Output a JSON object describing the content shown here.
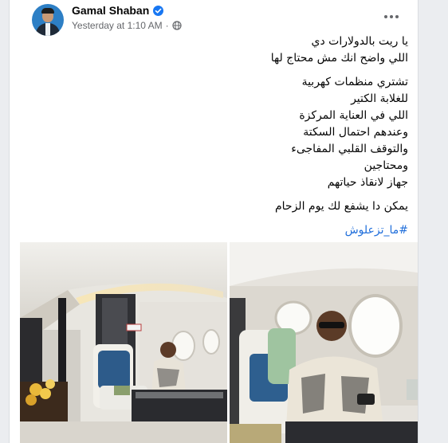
{
  "post": {
    "author": "Gamal Shaban",
    "timestamp": "Yesterday at 1:10 AM",
    "separator": "·",
    "privacy_icon": "globe-icon",
    "verified_icon": "verified-badge-icon",
    "more_icon": "more-options-icon",
    "paragraphs": [
      [
        "يا ريت بالدولارات دي",
        "اللي واضح انك مش محتاج لها"
      ],
      [
        "تشتري منظمات كهربية",
        "للغلابة الكتير",
        " اللي في العناية المركزة",
        "وعندهم احتمال السكتة",
        "والتوقف القلبي المفاجىء",
        "ومحتاجين",
        "جهاز لانقاذ حياتهم"
      ],
      [
        "يمكن دا يشفع لك يوم الزحام"
      ]
    ],
    "hashtag": "#ما_تزعلوش",
    "photos": [
      "private-jet-cabin-photo",
      "passenger-seat-photo"
    ]
  },
  "colors": {
    "page_background": "#ebedf0",
    "card_background": "#ffffff",
    "text_primary": "#050505",
    "text_secondary": "#65676b",
    "link": "#216fdb",
    "verified": "#1877f2"
  }
}
